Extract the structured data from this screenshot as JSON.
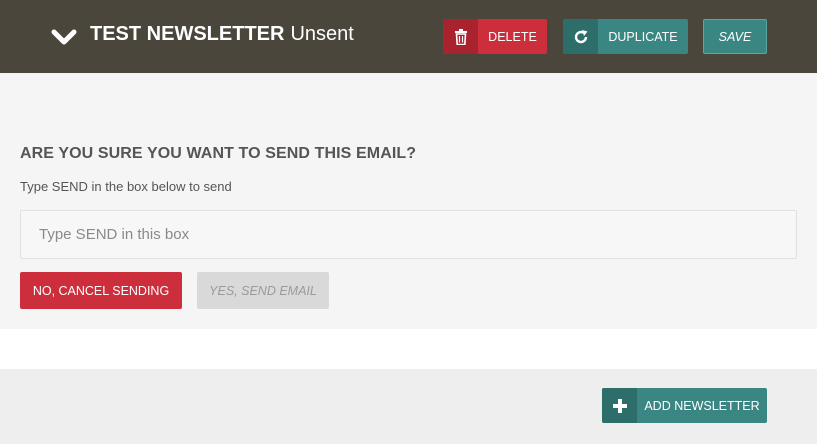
{
  "header": {
    "title": "TEST NEWSLETTER",
    "status": "Unsent",
    "delete_label": "DELETE",
    "duplicate_label": "DUPLICATE",
    "save_label": "SAVE"
  },
  "confirm": {
    "heading": "ARE YOU SURE YOU WANT TO SEND THIS EMAIL?",
    "help": "Type SEND in the box below to send",
    "input_placeholder": "Type SEND in this box",
    "input_value": "",
    "cancel_label": "NO, CANCEL SENDING",
    "send_label": "YES, SEND EMAIL"
  },
  "footer": {
    "add_label": "ADD NEWSLETTER"
  },
  "colors": {
    "header_bg": "#4a463c",
    "danger": "#cc2e3b",
    "teal": "#3a8683",
    "panel_bg": "#f5f5f5",
    "footer_bg": "#eeeeee"
  }
}
